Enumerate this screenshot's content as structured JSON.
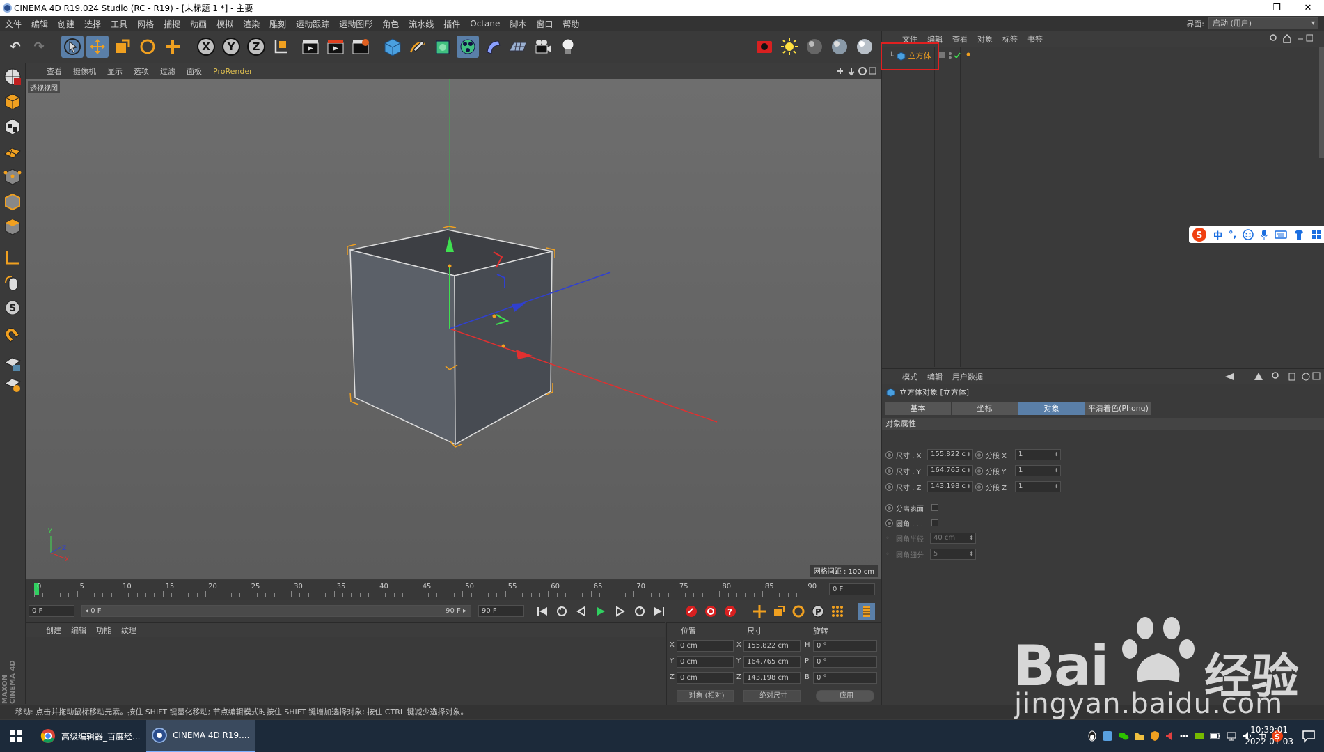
{
  "window": {
    "title": "CINEMA 4D R19.024 Studio (RC - R19) - [未标题 1 *] - 主要",
    "minimize": "–",
    "restore": "❐",
    "close": "✕"
  },
  "menubar": {
    "items": [
      "文件",
      "编辑",
      "创建",
      "选择",
      "工具",
      "网格",
      "捕捉",
      "动画",
      "模拟",
      "渲染",
      "雕刻",
      "运动跟踪",
      "运动图形",
      "角色",
      "流水线",
      "插件",
      "Octane",
      "脚本",
      "窗口",
      "帮助"
    ],
    "layout_label": "界面:",
    "layout_value": "启动 (用户)"
  },
  "toolbar": {
    "undo": "↶",
    "redo": "↷",
    "axis_x": "X",
    "axis_y": "Y",
    "axis_z": "Z"
  },
  "viewport": {
    "menu": [
      "查看",
      "摄像机",
      "显示",
      "选项",
      "过滤",
      "面板",
      "ProRender"
    ],
    "label": "透视视图",
    "grid_spacing": "网格间距 : 100 cm"
  },
  "timeline": {
    "ticks": [
      "0",
      "5",
      "10",
      "15",
      "20",
      "25",
      "30",
      "35",
      "40",
      "45",
      "50",
      "55",
      "60",
      "65",
      "70",
      "75",
      "80",
      "85",
      "90"
    ],
    "current_frame": "0 F",
    "start_frame": "0 F",
    "range_start": "◂ 0 F",
    "range_end": "90 F ▸",
    "end_frame": "90 F"
  },
  "material_panel": {
    "menu": [
      "创建",
      "编辑",
      "功能",
      "纹理"
    ]
  },
  "coord_panel": {
    "headers": {
      "pos": "位置",
      "size": "尺寸",
      "rot": "旋转"
    },
    "rows": [
      {
        "axis": "X",
        "pos": "0 cm",
        "size_axis": "X",
        "size": "155.822 cm",
        "rot_axis": "H",
        "rot": "0 °"
      },
      {
        "axis": "Y",
        "pos": "0 cm",
        "size_axis": "Y",
        "size": "164.765 cm",
        "rot_axis": "P",
        "rot": "0 °"
      },
      {
        "axis": "Z",
        "pos": "0 cm",
        "size_axis": "Z",
        "size": "143.198 cm",
        "rot_axis": "B",
        "rot": "0 °"
      }
    ],
    "mode_select": "对象 (相对)",
    "size_select": "绝对尺寸",
    "apply": "应用"
  },
  "status": "移动: 点击并拖动鼠标移动元素。按住 SHIFT 键量化移动; 节点编辑模式时按住 SHIFT 键增加选择对象; 按住 CTRL 键减少选择对象。",
  "object_manager": {
    "menu": [
      "文件",
      "编辑",
      "查看",
      "对象",
      "标签",
      "书签"
    ],
    "objects": [
      {
        "name": "立方体"
      }
    ]
  },
  "attribute_manager": {
    "menu": [
      "模式",
      "编辑",
      "用户数据"
    ],
    "object_title": "立方体对象 [立方体]",
    "tabs": [
      "基本",
      "坐标",
      "对象",
      "平滑着色(Phong)"
    ],
    "active_tab": "对象",
    "section": "对象属性",
    "size_x_label": "尺寸 . X",
    "size_x": "155.822 c",
    "size_y_label": "尺寸 . Y",
    "size_y": "164.765 c",
    "size_z_label": "尺寸 . Z",
    "size_z": "143.198 c",
    "seg_x_label": "分段 X",
    "seg_x": "1",
    "seg_y_label": "分段 Y",
    "seg_y": "1",
    "seg_z_label": "分段 Z",
    "seg_z": "1",
    "separate_label": "分离表面",
    "fillet_label": "圆角 . . .",
    "fillet_radius_label": "圆角半径",
    "fillet_radius": "40 cm",
    "fillet_sub_label": "圆角细分",
    "fillet_sub": "5"
  },
  "ime": {
    "lang": "中",
    "punct": "°,"
  },
  "taskbar": {
    "tasks": [
      {
        "label": "高级编辑器_百度经..."
      },
      {
        "label": "CINEMA 4D R19...."
      }
    ],
    "tray_lang": "中",
    "time": "10:39:01",
    "date": "2022-01-03"
  },
  "watermark": {
    "brand": "Bai",
    "brand2": "经验",
    "url": "jingyan.baidu.com"
  },
  "left_brand": "MAXON CINEMA 4D",
  "colors": {
    "accent": "#5a7fa8",
    "cube_highlight": "#f0b030",
    "red_box": "#e02020"
  }
}
